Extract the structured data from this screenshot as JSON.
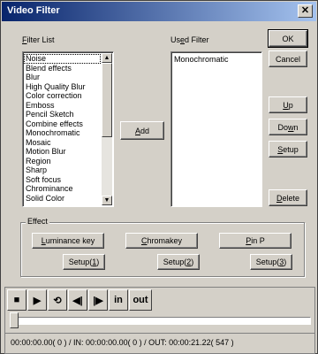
{
  "window": {
    "title": "Video Filter",
    "close_glyph": "✕"
  },
  "filter_list": {
    "label_accel": "F",
    "label_rest": "ilter List",
    "items": [
      "Noise",
      "Blend effects",
      "Blur",
      "High Quality Blur",
      "Color correction",
      "Emboss",
      "Pencil Sketch",
      "Combine effects",
      "Monochromatic",
      "Mosaic",
      "Motion Blur",
      "Region",
      "Sharp",
      "Soft focus",
      "Chrominance",
      "Solid Color"
    ],
    "selected_index": 0
  },
  "used_filter": {
    "label_pre": "Us",
    "label_accel": "e",
    "label_rest": "d Filter",
    "items": [
      "Monochromatic"
    ]
  },
  "buttons": {
    "ok": "OK",
    "cancel": "Cancel",
    "add_accel": "A",
    "add_rest": "dd",
    "up_accel": "U",
    "up_rest": "p",
    "down_pre": "Do",
    "down_accel": "w",
    "down_rest": "n",
    "setup_accel": "S",
    "setup_rest": "etup",
    "delete_accel": "D",
    "delete_rest": "elete"
  },
  "effect": {
    "group_label": "Effect",
    "luma_accel": "L",
    "luma_rest": "uminance key",
    "chroma_accel": "C",
    "chroma_rest": "hromakey",
    "pip_accel": "P",
    "pip_rest": " in P",
    "setup1_pre": "Setup(",
    "setup1_accel": "1",
    "setup1_post": ")",
    "setup2_pre": "Setup(",
    "setup2_accel": "2",
    "setup2_post": ")",
    "setup3_pre": "Setup(",
    "setup3_accel": "3",
    "setup3_post": ")"
  },
  "player": {
    "controls": [
      {
        "name": "stop-icon",
        "glyph": "■"
      },
      {
        "name": "play-icon",
        "glyph": "▶"
      },
      {
        "name": "loop-icon",
        "glyph": "⟲"
      },
      {
        "name": "prev-frame-icon",
        "glyph": "◀|"
      },
      {
        "name": "next-frame-icon",
        "glyph": "|▶"
      },
      {
        "name": "mark-in-button",
        "glyph": "in"
      },
      {
        "name": "mark-out-button",
        "glyph": "out"
      }
    ],
    "position_fraction": 0.0,
    "status": "00:00:00.00( 0 ) / IN: 00:00:00.00( 0 ) / OUT: 00:00:21.22( 547 )"
  }
}
